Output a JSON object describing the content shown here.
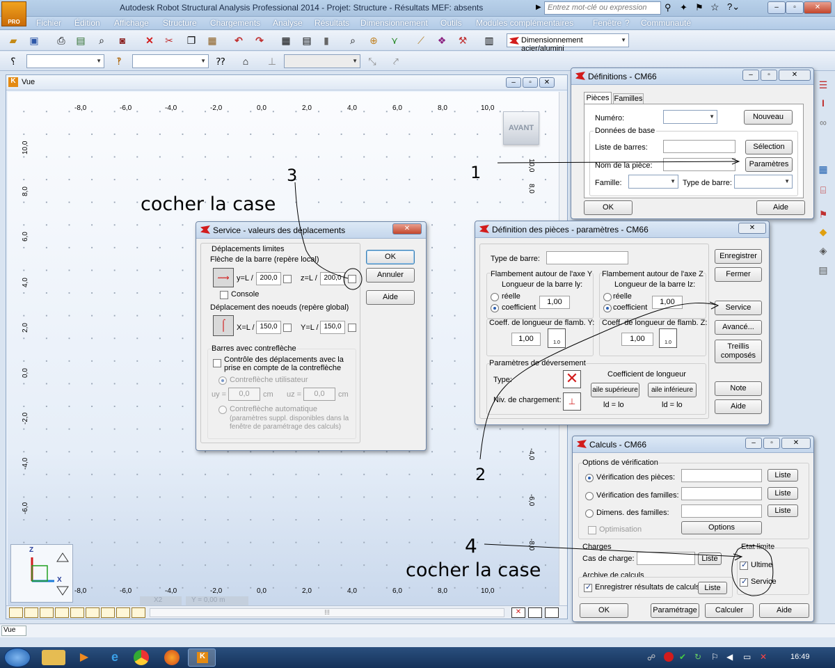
{
  "app": {
    "title": "Autodesk Robot Structural Analysis Professional 2014 - Projet: Structure - Résultats MEF: absents",
    "logo_text": "PRO",
    "search_placeholder": "Entrez mot-clé ou expression"
  },
  "menu": [
    "Fichier",
    "Édition",
    "Affichage",
    "Structure",
    "Chargements",
    "Analyse",
    "Résultats",
    "Dimensionnement",
    "Outils",
    "Modules complémentaires",
    "Fenêtre",
    "?",
    "Communauté"
  ],
  "toolbar": {
    "layout_combo": "Dimensionnement acier/alumini"
  },
  "vue": {
    "title": "Vue",
    "view_cube_label": "AVANT",
    "x_ticks": [
      "-8,0",
      "-6,0",
      "-4,0",
      "-2,0",
      "0,0",
      "2,0",
      "4,0",
      "6,0",
      "8,0",
      "10,0"
    ],
    "y_ticks": [
      "10,0",
      "8,0",
      "6,0",
      "4,0",
      "2,0",
      "0,0",
      "-2,0",
      "-4,0",
      "-6,0",
      "-8,0"
    ],
    "axis_z": "Z",
    "axis_x": "X",
    "coord_x": "X2",
    "coord_y": "Y = 0,00 m"
  },
  "definitions": {
    "title": "Définitions - CM66",
    "tab_pieces": "Pièces",
    "tab_familles": "Familles",
    "numero_label": "Numéro:",
    "nouveau": "Nouveau",
    "donnees_base": "Données de base",
    "liste_barres": "Liste de barres:",
    "selection": "Sélection",
    "nom_piece": "Nom de la pièce:",
    "parametres": "Paramètres",
    "famille": "Famille:",
    "type_barre": "Type de barre:",
    "ok": "OK",
    "aide": "Aide"
  },
  "params": {
    "title": "Définition des pièces - paramètres - CM66",
    "type_barre": "Type de barre:",
    "enregistrer": "Enregistrer",
    "fermer": "Fermer",
    "flamb_y": "Flambement autour de l'axe Y",
    "flamb_z": "Flambement autour de l'axe Z",
    "long_y": "Longueur de la barre ly:",
    "long_z": "Longueur de la barre lz:",
    "reelle": "réelle",
    "coefficient": "coefficient",
    "val_y": "1,00",
    "val_z": "1,00",
    "coeff_y": "Coeff. de longueur de flamb. Y:",
    "coeff_z": "Coeff. de longueur de flamb. Z:",
    "coeff_y_val": "1,00",
    "coeff_z_val": "1,00",
    "icon_val": "1.0",
    "service": "Service",
    "avance": "Avancé...",
    "treillis": "Treillis composés",
    "deversement": "Paramètres de déversement",
    "coeff_longueur": "Coefficient de longueur",
    "type": "Type:",
    "niv_charg": "Niv. de chargement:",
    "aile_sup": "aile supérieure",
    "aile_inf": "aile inférieure",
    "ld1": "ld = lo",
    "ld2": "ld = lo",
    "note": "Note",
    "aide": "Aide"
  },
  "service": {
    "title": "Service - valeurs des déplacements",
    "deplacements_limites": "Déplacements limites",
    "fleche": "Flèche de la barre (repère local)",
    "y_l": "y=L /",
    "y_val": "200,0",
    "z_l": "z=L /",
    "z_val": "200,0",
    "console": "Console",
    "depl_noeuds": "Déplacement des noeuds (repère global)",
    "x_l": "X=L /",
    "x_val": "150,0",
    "y2_l": "Y=L /",
    "y2_val": "150,0",
    "contrefleche": "Barres avec contreflèche",
    "controle": "Contrôle des déplacements avec la prise en compte de la contreflèche",
    "contre_util": "Contreflèche utilisateur",
    "uy": "uy =",
    "uy_val": "0,0",
    "uz": "uz =",
    "uz_val": "0,0",
    "cm": "cm",
    "contre_auto": "Contreflèche automatique",
    "contre_auto_note": "(paramètres suppl. disponibles dans la fenêtre de paramétrage des calculs)",
    "ok": "OK",
    "annuler": "Annuler",
    "aide": "Aide"
  },
  "calculs": {
    "title": "Calculs - CM66",
    "options": "Options de vérification",
    "verif_pieces": "Vérification des pièces:",
    "verif_familles": "Vérification des familles:",
    "dimens_familles": "Dimens. des familles:",
    "liste": "Liste",
    "optimisation": "Optimisation",
    "options_btn": "Options",
    "charges": "Charges",
    "cas_charge": "Cas de charge:",
    "etat_limite": "Etat limite",
    "ultime": "Ultime",
    "service": "Service",
    "archive": "Archive de calculs",
    "enregistrer": "Enregistrer résultats de calculs",
    "ok": "OK",
    "parametrage": "Paramétrage",
    "calculer": "Calculer",
    "aide": "Aide"
  },
  "annotations": {
    "n1": "1",
    "n2": "2",
    "n3": "3",
    "n4": "4",
    "cocher1": "cocher la case",
    "cocher2": "cocher la case"
  },
  "status": {
    "vue_label": "Vue",
    "clock": "16:49"
  }
}
